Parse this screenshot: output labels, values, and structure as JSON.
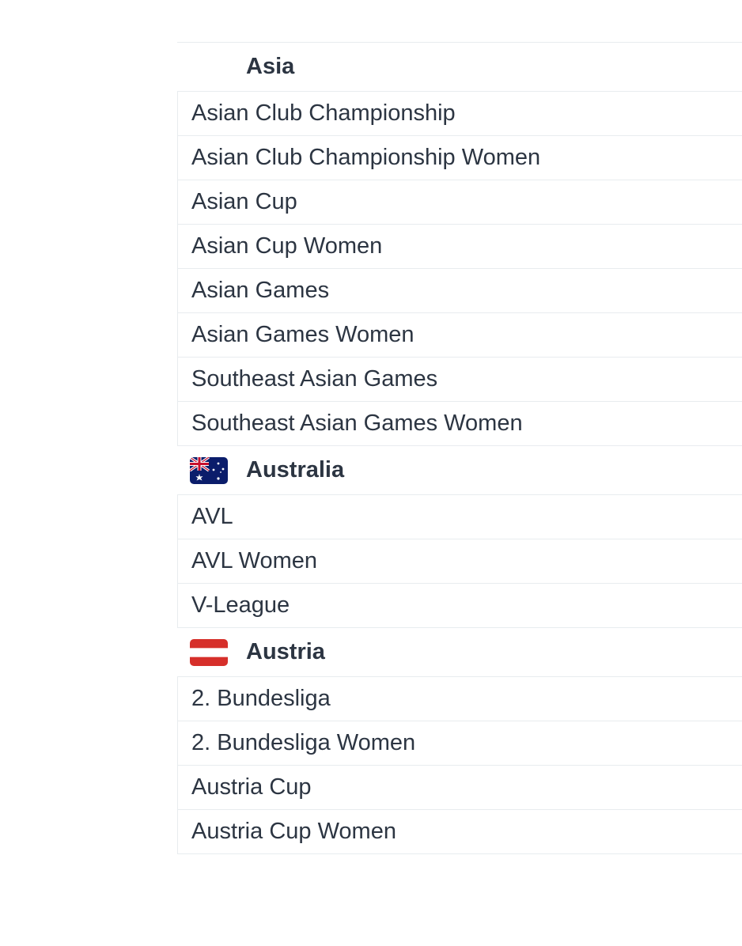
{
  "groups": [
    {
      "name": "Asia",
      "flag": "none",
      "items": [
        "Asian Club Championship",
        "Asian Club Championship Women",
        "Asian Cup",
        "Asian Cup Women",
        "Asian Games",
        "Asian Games Women",
        "Southeast Asian Games",
        "Southeast Asian Games Women"
      ]
    },
    {
      "name": "Australia",
      "flag": "australia-flag-icon",
      "items": [
        "AVL",
        "AVL Women",
        "V-League"
      ]
    },
    {
      "name": "Austria",
      "flag": "austria-flag-icon",
      "items": [
        "2. Bundesliga",
        "2. Bundesliga Women",
        "Austria Cup",
        "Austria Cup Women"
      ]
    }
  ],
  "colors": {
    "text": "#2c3542",
    "divider": "#e8ecef",
    "austria_red": "#d62f2a",
    "australia_blue": "#0b1d6b"
  }
}
